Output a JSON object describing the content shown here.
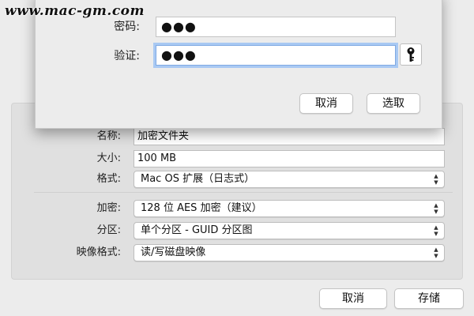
{
  "watermark": "www.mac-gm.com",
  "password_sheet": {
    "password_label": "密码:",
    "password_value": "●●●",
    "verify_label": "验证:",
    "verify_value": "●●●",
    "key_icon": "key-icon",
    "cancel_label": "取消",
    "choose_label": "选取"
  },
  "form": {
    "name_label": "名称:",
    "name_value": "加密文件夹",
    "size_label": "大小:",
    "size_value": "100 MB",
    "format_label": "格式:",
    "format_value": "Mac OS 扩展（日志式）",
    "encryption_label": "加密:",
    "encryption_value": "128 位 AES 加密（建议）",
    "partition_label": "分区:",
    "partition_value": "单个分区 - GUID 分区图",
    "image_format_label": "映像格式:",
    "image_format_value": "读/写磁盘映像"
  },
  "footer": {
    "cancel_label": "取消",
    "save_label": "存储"
  },
  "colors": {
    "focus_ring": "#a9c9f3",
    "window_bg": "#ececec"
  }
}
